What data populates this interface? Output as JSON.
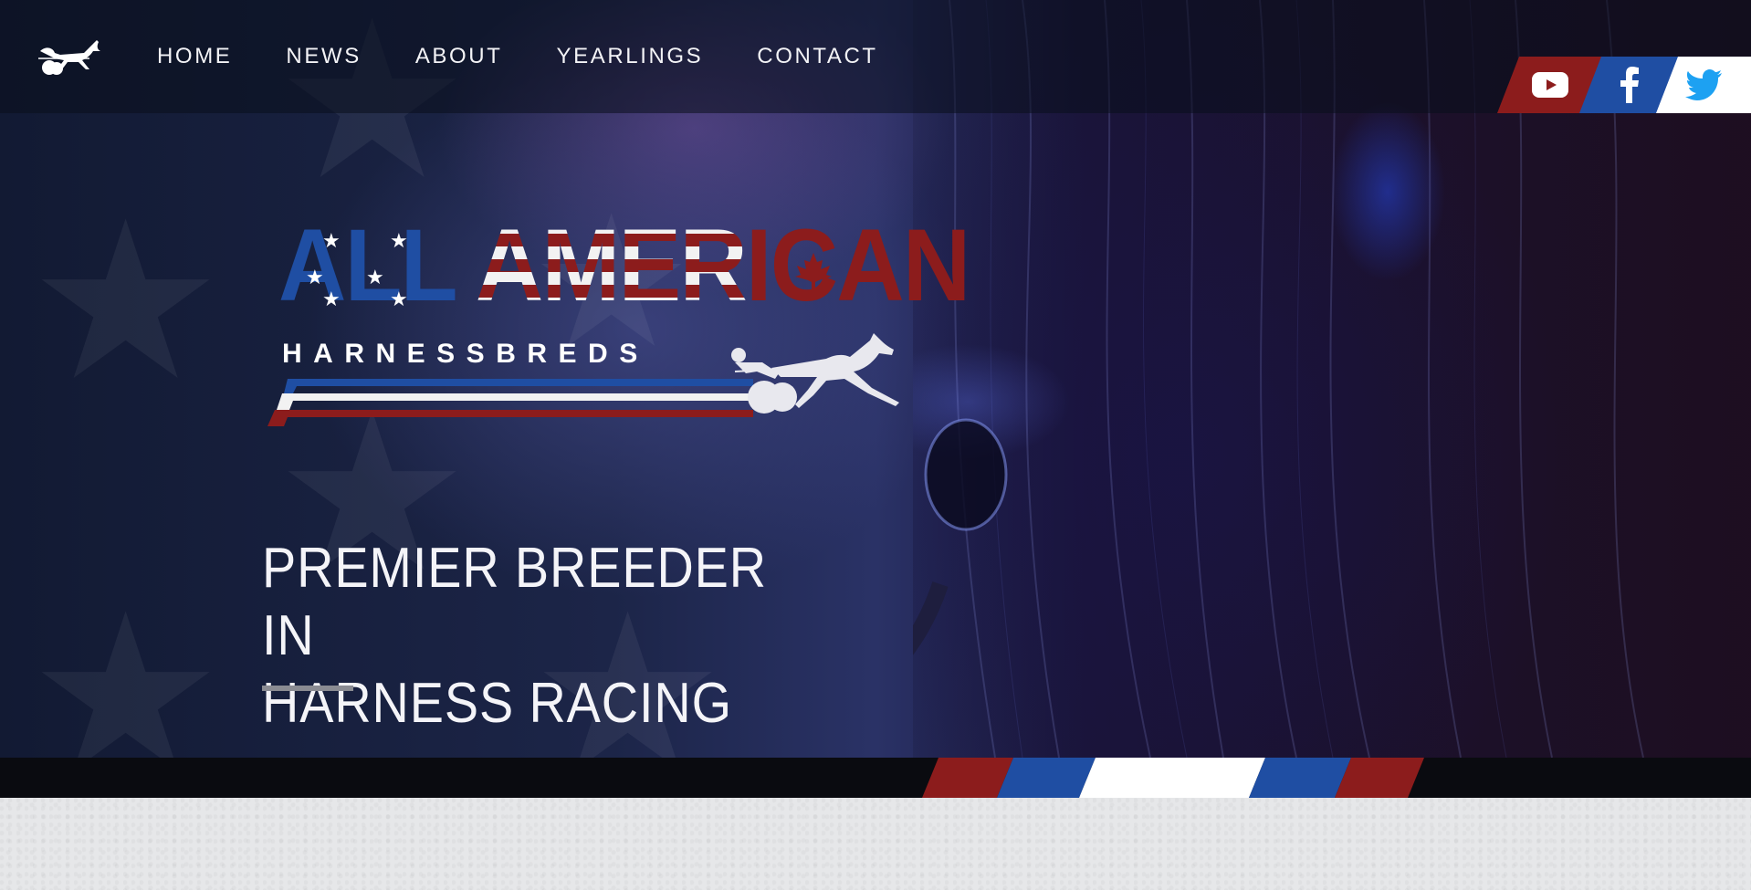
{
  "nav": {
    "logo_icon": "harness-sulky-icon",
    "links": [
      "HOME",
      "NEWS",
      "ABOUT",
      "YEARLINGS",
      "CONTACT"
    ]
  },
  "social": {
    "items": [
      {
        "icon": "youtube-icon",
        "color": "#8c1c1c"
      },
      {
        "icon": "facebook-icon",
        "color": "#1f4ea3"
      },
      {
        "icon": "twitter-icon",
        "color": "#ffffff"
      }
    ]
  },
  "brand": {
    "title_part1": "ALL ",
    "title_part2": "AMER",
    "title_part3": "ICAN",
    "subtitle": "HARNESSBREDS",
    "colors": {
      "red": "#8c1c1c",
      "blue": "#1f4ea3",
      "white": "#f2f2f2"
    }
  },
  "hero": {
    "headline_line1": "PREMIER BREEDER IN",
    "headline_line2": "HARNESS RACING"
  }
}
